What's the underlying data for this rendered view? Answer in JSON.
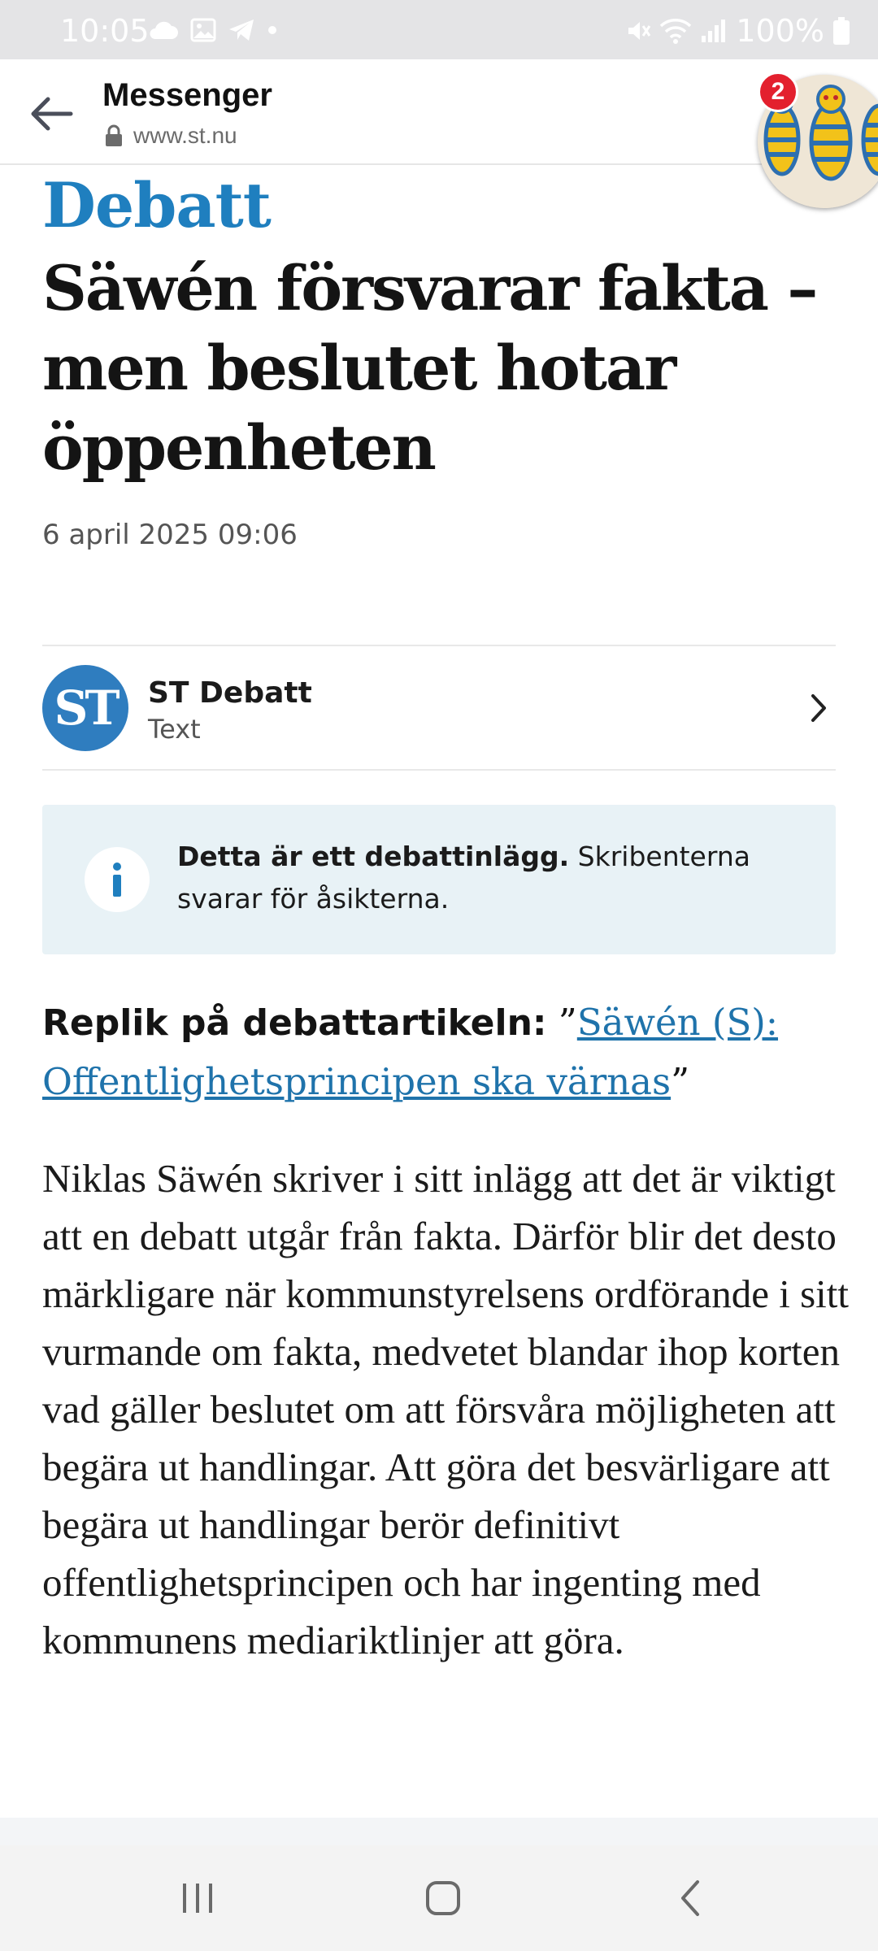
{
  "status_bar": {
    "time": "10:05",
    "battery": "100%"
  },
  "browser": {
    "title": "Messenger",
    "url": "www.st.nu",
    "back_icon": "arrow-left-icon",
    "lock_icon": "lock-icon"
  },
  "chat_head": {
    "badge_count": "2"
  },
  "article": {
    "kicker": "Debatt",
    "headline": "Säwén försvarar fakta – men beslutet hotar öppenheten",
    "date": "6 april 2025 09:06",
    "author": {
      "logo_text": "ST",
      "name": "ST Debatt",
      "role": "Text"
    },
    "info_box": {
      "bold": "Detta är ett debattinlägg.",
      "text": " Skribenterna svarar för åsikterna."
    },
    "reply": {
      "lead": "Replik på debattartikeln:",
      "open_quote": " ”",
      "link": "Säwén (S): Offentlighetsprincipen ska värnas",
      "close_quote": "”"
    },
    "body": "Niklas Säwén skriver i sitt inlägg att det är viktigt att en debatt utgår från fakta. Därför blir det desto märkligare när kommunstyrelsens ordförande i sitt vurmande om fakta, medvetet blandar ihop korten vad gäller beslutet om att försvåra möjligheten att begära ut handlingar. Att göra det besvärligare att begära ut handlingar berör definitivt offentlighetsprincipen och har ingenting med kommunens mediariktlinjer att göra."
  },
  "colors": {
    "accent": "#1f7fbf",
    "link": "#1f73ab",
    "info_bg": "#e8f2f6",
    "badge": "#e3202e"
  }
}
